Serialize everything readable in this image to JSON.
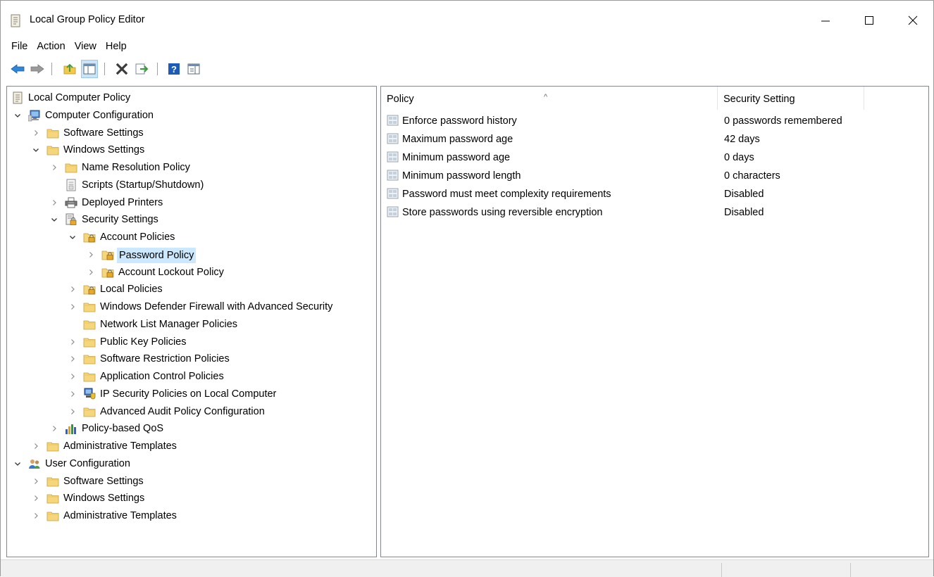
{
  "window": {
    "title": "Local Group Policy Editor"
  },
  "menu": {
    "items": [
      "File",
      "Action",
      "View",
      "Help"
    ]
  },
  "toolbar": {
    "buttons": [
      "back-icon",
      "forward-icon",
      "up-folder-icon",
      "show-hide-tree-icon",
      "delete-icon",
      "export-list-icon",
      "help-icon",
      "properties-view-icon"
    ]
  },
  "tree": {
    "items": [
      {
        "label": "Local Computer Policy",
        "expanded": null,
        "icon": "policy-scroll-icon"
      },
      {
        "label": "Computer Configuration",
        "expanded": true,
        "icon": "computer-config-icon"
      },
      {
        "label": "Software Settings",
        "expanded": false,
        "icon": "folder-icon"
      },
      {
        "label": "Windows Settings",
        "expanded": true,
        "icon": "folder-icon"
      },
      {
        "label": "Name Resolution Policy",
        "expanded": false,
        "icon": "folder-icon"
      },
      {
        "label": "Scripts (Startup/Shutdown)",
        "expanded": null,
        "icon": "script-icon"
      },
      {
        "label": "Deployed Printers",
        "expanded": false,
        "icon": "printer-icon"
      },
      {
        "label": "Security Settings",
        "expanded": true,
        "icon": "security-settings-icon"
      },
      {
        "label": "Account Policies",
        "expanded": true,
        "icon": "lock-folder-icon"
      },
      {
        "label": "Password Policy",
        "expanded": false,
        "icon": "lock-folder-icon",
        "selected": true
      },
      {
        "label": "Account Lockout Policy",
        "expanded": false,
        "icon": "lock-folder-icon"
      },
      {
        "label": "Local Policies",
        "expanded": false,
        "icon": "lock-folder-icon"
      },
      {
        "label": "Windows Defender Firewall with Advanced Security",
        "expanded": false,
        "icon": "folder-icon"
      },
      {
        "label": "Network List Manager Policies",
        "expanded": null,
        "icon": "folder-icon"
      },
      {
        "label": "Public Key Policies",
        "expanded": false,
        "icon": "folder-icon"
      },
      {
        "label": "Software Restriction Policies",
        "expanded": false,
        "icon": "folder-icon"
      },
      {
        "label": "Application Control Policies",
        "expanded": false,
        "icon": "folder-icon"
      },
      {
        "label": "IP Security Policies on Local Computer",
        "expanded": false,
        "icon": "ip-security-icon"
      },
      {
        "label": "Advanced Audit Policy Configuration",
        "expanded": false,
        "icon": "folder-icon"
      },
      {
        "label": "Policy-based QoS",
        "expanded": false,
        "icon": "qos-chart-icon"
      },
      {
        "label": "Administrative Templates",
        "expanded": false,
        "icon": "folder-icon"
      },
      {
        "label": "User Configuration",
        "expanded": true,
        "icon": "user-config-icon"
      },
      {
        "label": "Software Settings",
        "expanded": false,
        "icon": "folder-icon"
      },
      {
        "label": "Windows Settings",
        "expanded": false,
        "icon": "folder-icon"
      },
      {
        "label": "Administrative Templates",
        "expanded": false,
        "icon": "folder-icon"
      }
    ]
  },
  "list": {
    "columns": [
      "Policy",
      "Security Setting"
    ],
    "sort_indicator": "^",
    "rows": [
      {
        "policy": "Enforce password history",
        "setting": "0 passwords remembered"
      },
      {
        "policy": "Maximum password age",
        "setting": "42 days"
      },
      {
        "policy": "Minimum password age",
        "setting": "0 days"
      },
      {
        "policy": "Minimum password length",
        "setting": "0 characters"
      },
      {
        "policy": "Password must meet complexity requirements",
        "setting": "Disabled"
      },
      {
        "policy": "Store passwords using reversible encryption",
        "setting": "Disabled"
      }
    ]
  },
  "colors": {
    "selection": "#cce8ff",
    "accent_blue": "#1a73c7",
    "folder_yellow": "#f5d67a"
  }
}
